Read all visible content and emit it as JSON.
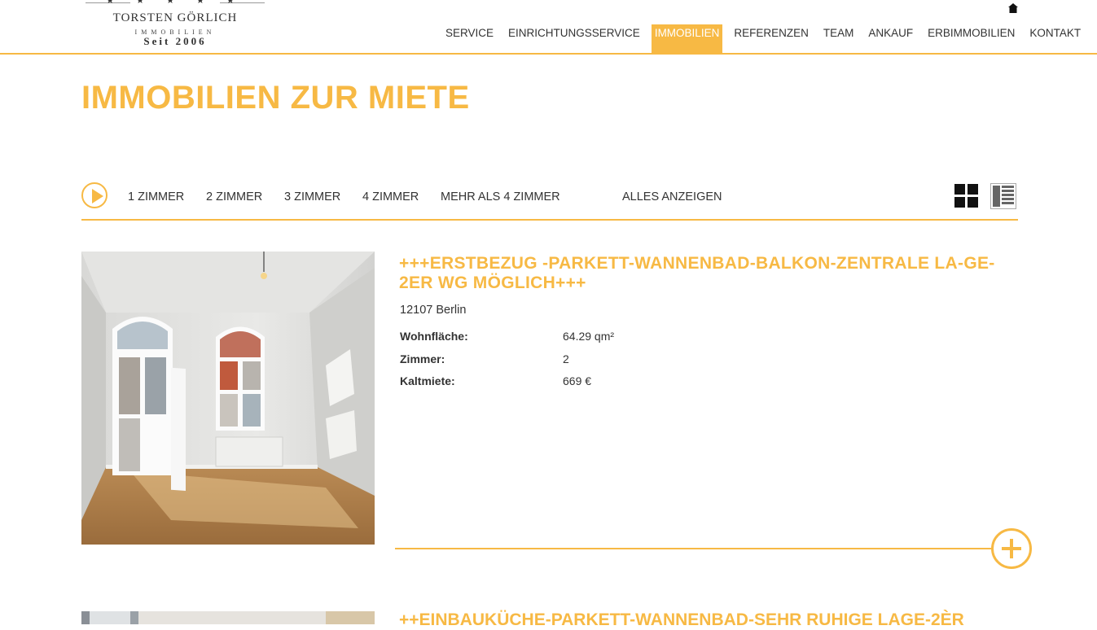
{
  "brand": {
    "stars": "★ ★ ★ ★ ★",
    "name": "TORSTEN GÖRLICH",
    "subtitle": "IMMOBILIEN",
    "since": "Seit 2006"
  },
  "nav": {
    "items": [
      "SERVICE",
      "EINRICHTUNGSSERVICE",
      "IMMOBILIEN",
      "REFERENZEN",
      "TEAM",
      "ANKAUF",
      "ERBIMMOBILIEN",
      "KONTAKT"
    ],
    "active": "IMMOBILIEN"
  },
  "page_title": "IMMOBILIEN ZUR MIETE",
  "filters": {
    "items": [
      "1 ZIMMER",
      "2 ZIMMER",
      "3 ZIMMER",
      "4 ZIMMER",
      "MEHR ALS 4 ZIMMER",
      "ALLES ANZEIGEN"
    ]
  },
  "listings": [
    {
      "title": "+++ERSTBEZUG -PARKETT-WANNENBAD-BALKON-ZENTRALE LA-GE-2ER WG MÖGLICH+++",
      "location": "12107 Berlin",
      "details": [
        {
          "label": "Wohnfläche:",
          "value": "64.29 qm²"
        },
        {
          "label": "Zimmer:",
          "value": "2"
        },
        {
          "label": "Kaltmiete:",
          "value": "669 €"
        }
      ]
    },
    {
      "title": "++EINBAUKÜCHE-PARKETT-WANNENBAD-SEHR RUHIGE LAGE-2Èr"
    }
  ],
  "colors": {
    "accent": "#f7b944",
    "text": "#333333"
  }
}
